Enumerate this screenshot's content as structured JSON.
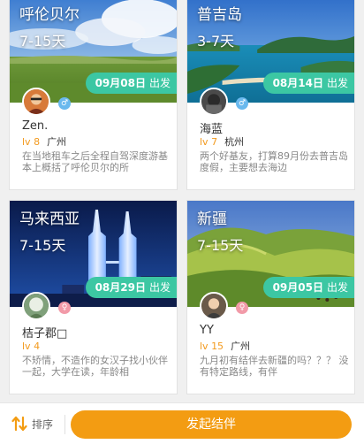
{
  "cards": [
    {
      "destination": "呼伦贝尔",
      "duration": "7-15天",
      "date": "09月08日",
      "depart": "出发",
      "name": "Zen.",
      "level": "lv 8",
      "city": "广州",
      "gender": "male",
      "gender_icon": "male-icon",
      "description": "在当地租车之后全程自驾深度游基本上概括了呼伦贝尔的所"
    },
    {
      "destination": "普吉岛",
      "duration": "3-7天",
      "date": "08月14日",
      "depart": "出发",
      "name": "海蓝",
      "level": "lv 7",
      "city": "杭州",
      "gender": "male",
      "gender_icon": "male-icon",
      "description": "两个好基友，打算89月份去普吉岛度假，主要想去海边"
    },
    {
      "destination": "马来西亚",
      "duration": "7-15天",
      "date": "08月29日",
      "depart": "出发",
      "name": "桔子郡□",
      "level": "lv 4",
      "city": "",
      "gender": "female",
      "gender_icon": "female-icon",
      "description": "不矫情，不造作的女汉子找小伙伴一起，大学在读，年龄相"
    },
    {
      "destination": "新疆",
      "duration": "7-15天",
      "date": "09月05日",
      "depart": "出发",
      "name": "YY",
      "level": "lv 15",
      "city": "广州",
      "gender": "female",
      "gender_icon": "female-icon",
      "description": "九月初有结伴去新疆的吗？？？ 没有特定路线，有伴"
    }
  ],
  "bottom": {
    "sort_label": "排序",
    "cta_label": "发起结伴"
  },
  "colors": {
    "accent_green": "#3cc7a3",
    "accent_orange": "#f39c12",
    "level_orange": "#f39a1e"
  }
}
